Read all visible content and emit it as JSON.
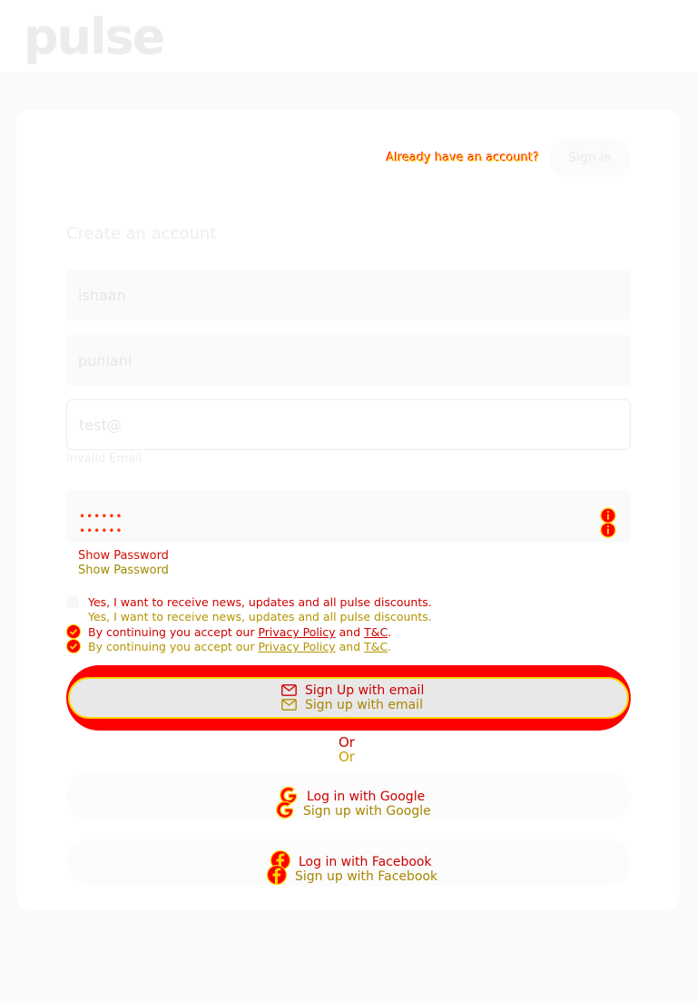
{
  "header": {
    "logo_text": "pulse"
  },
  "auth": {
    "have_account_a": "Already have an account?",
    "have_account_b": "Already have an account?",
    "signin_label": "Sign in"
  },
  "form": {
    "title": "Create an account",
    "first_name_value": "ishaan",
    "last_name_value": "puniani",
    "email_value": "test@",
    "email_error": "Invalid Email",
    "password_mask_a": "••••••",
    "password_mask_b": "••••••",
    "show_password_a": "Show Password",
    "show_password_b": "Show Password"
  },
  "consent": {
    "newsletter_a": "Yes, I want to receive news, updates and all pulse discounts.",
    "newsletter_b": "Yes, I want to receive news, updates and all pulse discounts.",
    "terms_prefix": "By continuing you accept our ",
    "privacy_link": "Privacy Policy",
    "and_word": " and ",
    "tc_link": "T&C",
    "terms_suffix": "."
  },
  "buttons": {
    "email_signup_a": "Sign Up with email",
    "email_signup_b": "Sign up with email",
    "or_a": "Or",
    "or_b": "Or",
    "google_a": "Log in with Google",
    "google_b": "Sign up with Google",
    "facebook_a": "Log in with Facebook",
    "facebook_b": "Sign up with Facebook"
  },
  "colors": {
    "accent_red": "#ff0000",
    "accent_yellow": "#ffd400",
    "background": "#fafafa"
  },
  "icons": [
    "info-icon",
    "checkbox-checked-icon",
    "mail-icon",
    "google-icon",
    "facebook-icon"
  ]
}
